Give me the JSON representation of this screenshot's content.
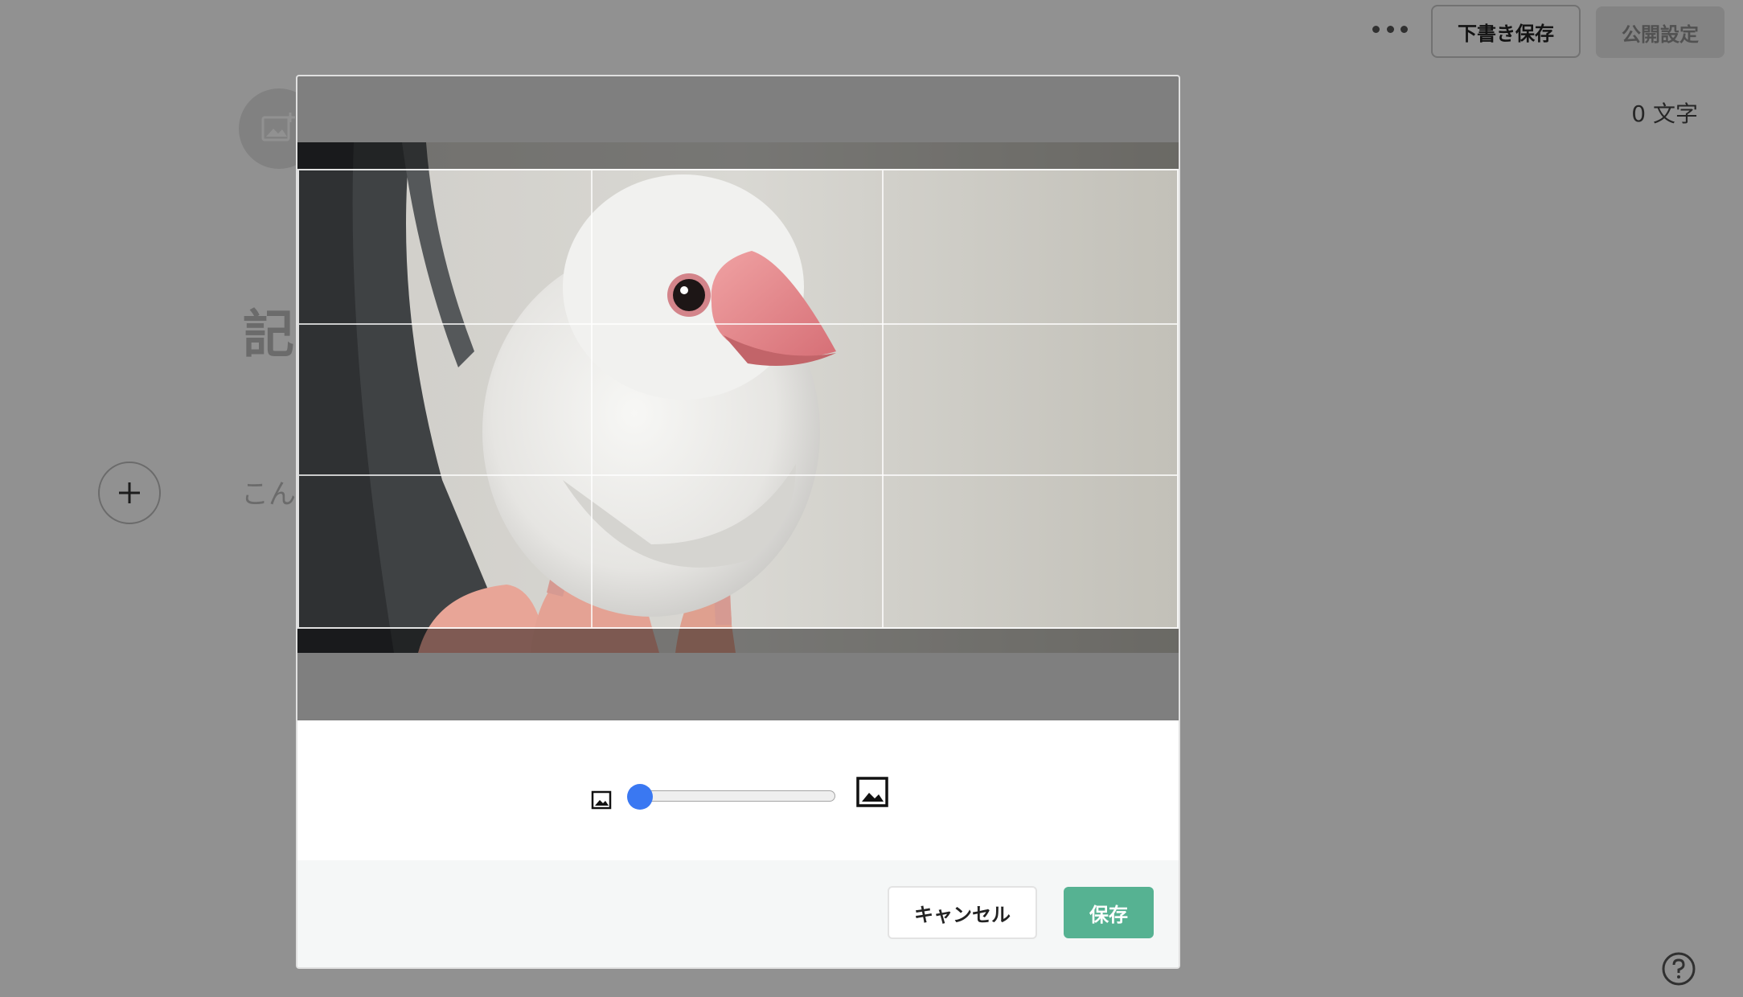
{
  "header": {
    "more_icon": "more-horizontal-icon",
    "save_draft_label": "下書き保存",
    "publish_settings_label": "公開設定"
  },
  "editor": {
    "char_count": "0 文字",
    "cover_icon": "image-add-icon",
    "title_placeholder_visible": "記",
    "body_placeholder_visible": "こん",
    "add_block_icon": "plus-icon",
    "help_icon": "question-circle-icon"
  },
  "crop_modal": {
    "image_subject": "white java sparrow photo",
    "zoom": {
      "min_icon": "image-small-icon",
      "max_icon": "image-large-icon",
      "value": 0
    },
    "cancel_label": "キャンセル",
    "save_label": "保存",
    "colors": {
      "save_button": "#56b292",
      "slider_thumb": "#3a78f2"
    }
  }
}
